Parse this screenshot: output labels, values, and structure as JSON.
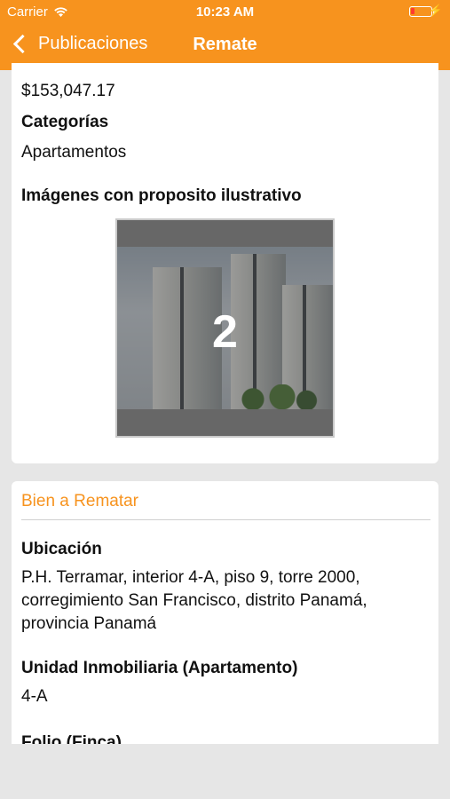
{
  "status_bar": {
    "carrier": "Carrier",
    "time": "10:23 AM"
  },
  "nav": {
    "back_label": "Publicaciones",
    "title": "Remate"
  },
  "summary": {
    "price": "$153,047.17",
    "categories_heading": "Categorías",
    "category": "Apartamentos",
    "images_heading": "Imágenes con proposito ilustrativo",
    "image_counter": "2"
  },
  "bien": {
    "section_title": "Bien a Rematar",
    "ubicacion_heading": "Ubicación",
    "ubicacion_value": "P.H. Terramar, interior 4-A, piso 9, torre 2000, corregimiento San Francisco, distrito Panamá, provincia Panamá",
    "unidad_heading": "Unidad Inmobiliaria (Apartamento)",
    "unidad_value": "4-A",
    "folio_heading": "Folio (Finca)"
  },
  "colors": {
    "accent": "#f7931e",
    "background": "#e6e6e6",
    "card": "#ffffff"
  },
  "icons": [
    "wifi-icon",
    "battery-icon",
    "charging-bolt-icon",
    "chevron-left-icon"
  ]
}
